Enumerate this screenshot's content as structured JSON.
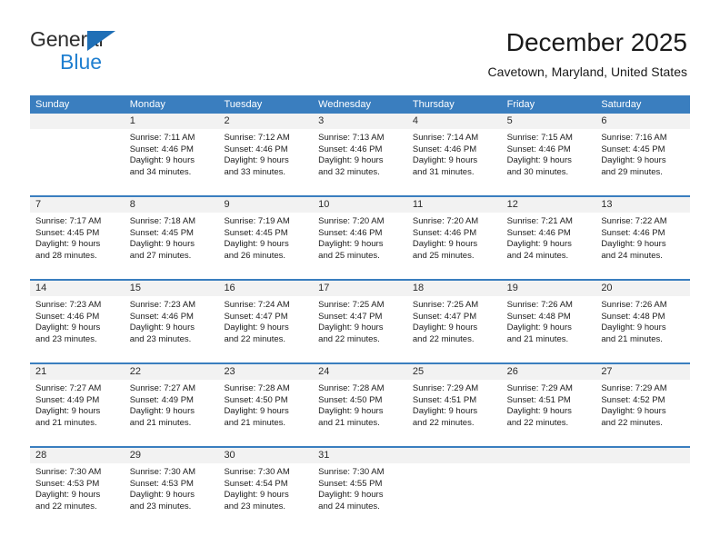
{
  "brand": {
    "line1": "General",
    "line2": "Blue",
    "triangle_color": "#1f6fb6",
    "blue_text_color": "#1f7fd0"
  },
  "header": {
    "title": "December 2025",
    "subtitle": "Cavetown, Maryland, United States"
  },
  "theme": {
    "header_bar_color": "#3a7ebf",
    "day_number_band_color": "#f2f2f2",
    "text_color": "#1c1c1c"
  },
  "calendar": {
    "weekdays": [
      "Sunday",
      "Monday",
      "Tuesday",
      "Wednesday",
      "Thursday",
      "Friday",
      "Saturday"
    ],
    "weeks": [
      [
        {
          "day": "",
          "sunrise": "",
          "sunset": "",
          "daylight_line1": "",
          "daylight_line2": ""
        },
        {
          "day": "1",
          "sunrise": "Sunrise: 7:11 AM",
          "sunset": "Sunset: 4:46 PM",
          "daylight_line1": "Daylight: 9 hours",
          "daylight_line2": "and 34 minutes."
        },
        {
          "day": "2",
          "sunrise": "Sunrise: 7:12 AM",
          "sunset": "Sunset: 4:46 PM",
          "daylight_line1": "Daylight: 9 hours",
          "daylight_line2": "and 33 minutes."
        },
        {
          "day": "3",
          "sunrise": "Sunrise: 7:13 AM",
          "sunset": "Sunset: 4:46 PM",
          "daylight_line1": "Daylight: 9 hours",
          "daylight_line2": "and 32 minutes."
        },
        {
          "day": "4",
          "sunrise": "Sunrise: 7:14 AM",
          "sunset": "Sunset: 4:46 PM",
          "daylight_line1": "Daylight: 9 hours",
          "daylight_line2": "and 31 minutes."
        },
        {
          "day": "5",
          "sunrise": "Sunrise: 7:15 AM",
          "sunset": "Sunset: 4:46 PM",
          "daylight_line1": "Daylight: 9 hours",
          "daylight_line2": "and 30 minutes."
        },
        {
          "day": "6",
          "sunrise": "Sunrise: 7:16 AM",
          "sunset": "Sunset: 4:45 PM",
          "daylight_line1": "Daylight: 9 hours",
          "daylight_line2": "and 29 minutes."
        }
      ],
      [
        {
          "day": "7",
          "sunrise": "Sunrise: 7:17 AM",
          "sunset": "Sunset: 4:45 PM",
          "daylight_line1": "Daylight: 9 hours",
          "daylight_line2": "and 28 minutes."
        },
        {
          "day": "8",
          "sunrise": "Sunrise: 7:18 AM",
          "sunset": "Sunset: 4:45 PM",
          "daylight_line1": "Daylight: 9 hours",
          "daylight_line2": "and 27 minutes."
        },
        {
          "day": "9",
          "sunrise": "Sunrise: 7:19 AM",
          "sunset": "Sunset: 4:45 PM",
          "daylight_line1": "Daylight: 9 hours",
          "daylight_line2": "and 26 minutes."
        },
        {
          "day": "10",
          "sunrise": "Sunrise: 7:20 AM",
          "sunset": "Sunset: 4:46 PM",
          "daylight_line1": "Daylight: 9 hours",
          "daylight_line2": "and 25 minutes."
        },
        {
          "day": "11",
          "sunrise": "Sunrise: 7:20 AM",
          "sunset": "Sunset: 4:46 PM",
          "daylight_line1": "Daylight: 9 hours",
          "daylight_line2": "and 25 minutes."
        },
        {
          "day": "12",
          "sunrise": "Sunrise: 7:21 AM",
          "sunset": "Sunset: 4:46 PM",
          "daylight_line1": "Daylight: 9 hours",
          "daylight_line2": "and 24 minutes."
        },
        {
          "day": "13",
          "sunrise": "Sunrise: 7:22 AM",
          "sunset": "Sunset: 4:46 PM",
          "daylight_line1": "Daylight: 9 hours",
          "daylight_line2": "and 24 minutes."
        }
      ],
      [
        {
          "day": "14",
          "sunrise": "Sunrise: 7:23 AM",
          "sunset": "Sunset: 4:46 PM",
          "daylight_line1": "Daylight: 9 hours",
          "daylight_line2": "and 23 minutes."
        },
        {
          "day": "15",
          "sunrise": "Sunrise: 7:23 AM",
          "sunset": "Sunset: 4:46 PM",
          "daylight_line1": "Daylight: 9 hours",
          "daylight_line2": "and 23 minutes."
        },
        {
          "day": "16",
          "sunrise": "Sunrise: 7:24 AM",
          "sunset": "Sunset: 4:47 PM",
          "daylight_line1": "Daylight: 9 hours",
          "daylight_line2": "and 22 minutes."
        },
        {
          "day": "17",
          "sunrise": "Sunrise: 7:25 AM",
          "sunset": "Sunset: 4:47 PM",
          "daylight_line1": "Daylight: 9 hours",
          "daylight_line2": "and 22 minutes."
        },
        {
          "day": "18",
          "sunrise": "Sunrise: 7:25 AM",
          "sunset": "Sunset: 4:47 PM",
          "daylight_line1": "Daylight: 9 hours",
          "daylight_line2": "and 22 minutes."
        },
        {
          "day": "19",
          "sunrise": "Sunrise: 7:26 AM",
          "sunset": "Sunset: 4:48 PM",
          "daylight_line1": "Daylight: 9 hours",
          "daylight_line2": "and 21 minutes."
        },
        {
          "day": "20",
          "sunrise": "Sunrise: 7:26 AM",
          "sunset": "Sunset: 4:48 PM",
          "daylight_line1": "Daylight: 9 hours",
          "daylight_line2": "and 21 minutes."
        }
      ],
      [
        {
          "day": "21",
          "sunrise": "Sunrise: 7:27 AM",
          "sunset": "Sunset: 4:49 PM",
          "daylight_line1": "Daylight: 9 hours",
          "daylight_line2": "and 21 minutes."
        },
        {
          "day": "22",
          "sunrise": "Sunrise: 7:27 AM",
          "sunset": "Sunset: 4:49 PM",
          "daylight_line1": "Daylight: 9 hours",
          "daylight_line2": "and 21 minutes."
        },
        {
          "day": "23",
          "sunrise": "Sunrise: 7:28 AM",
          "sunset": "Sunset: 4:50 PM",
          "daylight_line1": "Daylight: 9 hours",
          "daylight_line2": "and 21 minutes."
        },
        {
          "day": "24",
          "sunrise": "Sunrise: 7:28 AM",
          "sunset": "Sunset: 4:50 PM",
          "daylight_line1": "Daylight: 9 hours",
          "daylight_line2": "and 21 minutes."
        },
        {
          "day": "25",
          "sunrise": "Sunrise: 7:29 AM",
          "sunset": "Sunset: 4:51 PM",
          "daylight_line1": "Daylight: 9 hours",
          "daylight_line2": "and 22 minutes."
        },
        {
          "day": "26",
          "sunrise": "Sunrise: 7:29 AM",
          "sunset": "Sunset: 4:51 PM",
          "daylight_line1": "Daylight: 9 hours",
          "daylight_line2": "and 22 minutes."
        },
        {
          "day": "27",
          "sunrise": "Sunrise: 7:29 AM",
          "sunset": "Sunset: 4:52 PM",
          "daylight_line1": "Daylight: 9 hours",
          "daylight_line2": "and 22 minutes."
        }
      ],
      [
        {
          "day": "28",
          "sunrise": "Sunrise: 7:30 AM",
          "sunset": "Sunset: 4:53 PM",
          "daylight_line1": "Daylight: 9 hours",
          "daylight_line2": "and 22 minutes."
        },
        {
          "day": "29",
          "sunrise": "Sunrise: 7:30 AM",
          "sunset": "Sunset: 4:53 PM",
          "daylight_line1": "Daylight: 9 hours",
          "daylight_line2": "and 23 minutes."
        },
        {
          "day": "30",
          "sunrise": "Sunrise: 7:30 AM",
          "sunset": "Sunset: 4:54 PM",
          "daylight_line1": "Daylight: 9 hours",
          "daylight_line2": "and 23 minutes."
        },
        {
          "day": "31",
          "sunrise": "Sunrise: 7:30 AM",
          "sunset": "Sunset: 4:55 PM",
          "daylight_line1": "Daylight: 9 hours",
          "daylight_line2": "and 24 minutes."
        },
        {
          "day": "",
          "sunrise": "",
          "sunset": "",
          "daylight_line1": "",
          "daylight_line2": ""
        },
        {
          "day": "",
          "sunrise": "",
          "sunset": "",
          "daylight_line1": "",
          "daylight_line2": ""
        },
        {
          "day": "",
          "sunrise": "",
          "sunset": "",
          "daylight_line1": "",
          "daylight_line2": ""
        }
      ]
    ]
  }
}
